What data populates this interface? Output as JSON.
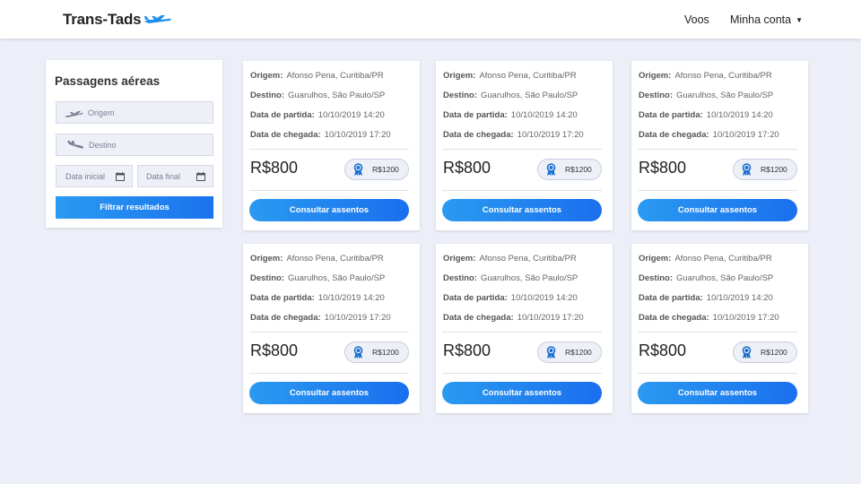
{
  "header": {
    "brand": "Trans-Tads",
    "nav_voos": "Voos",
    "nav_account": "Minha conta"
  },
  "filter": {
    "title": "Passagens aéreas",
    "origem_placeholder": "Origem",
    "destino_placeholder": "Destino",
    "date_start_placeholder": "Data inicial",
    "date_end_placeholder": "Data final",
    "button": "Filtrar resultados"
  },
  "labels": {
    "origem": "Origem:",
    "destino": "Destino:",
    "partida": "Data de partida:",
    "chegada": "Data de chegada:",
    "consultar": "Consultar assentos"
  },
  "flights": [
    {
      "origem": "Afonso Pena, Curitiba/PR",
      "destino": "Guarulhos, São Paulo/SP",
      "partida": "10/10/2019 14:20",
      "chegada": "10/10/2019 17:20",
      "price": "R$800",
      "miles": "R$1200"
    },
    {
      "origem": "Afonso Pena, Curitiba/PR",
      "destino": "Guarulhos, São Paulo/SP",
      "partida": "10/10/2019 14:20",
      "chegada": "10/10/2019 17:20",
      "price": "R$800",
      "miles": "R$1200"
    },
    {
      "origem": "Afonso Pena, Curitiba/PR",
      "destino": "Guarulhos, São Paulo/SP",
      "partida": "10/10/2019 14:20",
      "chegada": "10/10/2019 17:20",
      "price": "R$800",
      "miles": "R$1200"
    },
    {
      "origem": "Afonso Pena, Curitiba/PR",
      "destino": "Guarulhos, São Paulo/SP",
      "partida": "10/10/2019 14:20",
      "chegada": "10/10/2019 17:20",
      "price": "R$800",
      "miles": "R$1200"
    },
    {
      "origem": "Afonso Pena, Curitiba/PR",
      "destino": "Guarulhos, São Paulo/SP",
      "partida": "10/10/2019 14:20",
      "chegada": "10/10/2019 17:20",
      "price": "R$800",
      "miles": "R$1200"
    },
    {
      "origem": "Afonso Pena, Curitiba/PR",
      "destino": "Guarulhos, São Paulo/SP",
      "partida": "10/10/2019 14:20",
      "chegada": "10/10/2019 17:20",
      "price": "R$800",
      "miles": "R$1200"
    }
  ],
  "icons": {
    "brand": "airplane-icon",
    "origem": "plane-takeoff-icon",
    "destino": "plane-landing-icon",
    "calendar": "calendar-icon",
    "miles": "award-ribbon-icon"
  },
  "colors": {
    "accent": "#1a73ee",
    "accent_light": "#2a9af0",
    "background": "#eceef8"
  }
}
